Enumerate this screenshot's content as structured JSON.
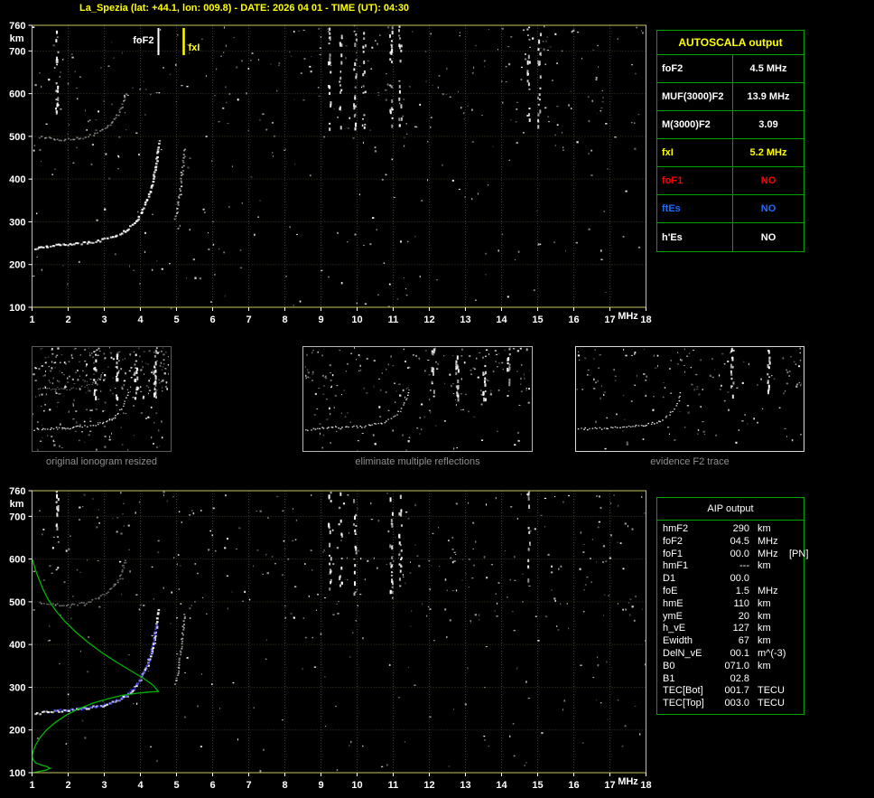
{
  "header": {
    "title": "La_Spezia (lat: +44.1, lon: 009.8) - DATE: 2026 04 01 - TIME (UT): 04:30"
  },
  "colors": {
    "title": "#ffff00",
    "chart_border": "#c6c65e",
    "grid": "#3c3c26",
    "axis_text": "#ffffff",
    "table_border": "#00a400",
    "caption": "#909090",
    "profile_green": "#00b400",
    "trace_blue": "#3b3bff",
    "marker_foF2": "#ffffff",
    "marker_fxI": "#ffff00",
    "status_red": "#ff0000",
    "status_blue": "#1e6bff"
  },
  "autoscala_table": {
    "title": "AUTOSCALA output",
    "rows": [
      {
        "label": "foF2",
        "value": "4.5 MHz",
        "color": "#ffffff"
      },
      {
        "label": "MUF(3000)F2",
        "value": "13.9 MHz",
        "color": "#ffffff"
      },
      {
        "label": "M(3000)F2",
        "value": "3.09",
        "color": "#ffffff"
      },
      {
        "label": "fxI",
        "value": "5.2 MHz",
        "color": "#ffff00"
      },
      {
        "label": "foF1",
        "value": "NO",
        "color": "#ff0000"
      },
      {
        "label": "ftEs",
        "value": "NO",
        "color": "#1e6bff"
      },
      {
        "label": "h'Es",
        "value": "NO",
        "color": "#ffffff"
      }
    ]
  },
  "aip_table": {
    "title": "AIP output",
    "rows": [
      {
        "label": "hmF2",
        "value": "290",
        "unit": "km",
        "note": ""
      },
      {
        "label": "foF2",
        "value": "04.5",
        "unit": "MHz",
        "note": ""
      },
      {
        "label": "foF1",
        "value": "00.0",
        "unit": "MHz",
        "note": "[PN]"
      },
      {
        "label": "hmF1",
        "value": "---",
        "unit": "km",
        "note": ""
      },
      {
        "label": "D1",
        "value": "00.0",
        "unit": "",
        "note": ""
      },
      {
        "label": "foE",
        "value": "1.5",
        "unit": "MHz",
        "note": ""
      },
      {
        "label": "hmE",
        "value": "110",
        "unit": "km",
        "note": ""
      },
      {
        "label": "ymE",
        "value": "20",
        "unit": "km",
        "note": ""
      },
      {
        "label": "h_vE",
        "value": "127",
        "unit": "km",
        "note": ""
      },
      {
        "label": "Ewidth",
        "value": "67",
        "unit": "km",
        "note": ""
      },
      {
        "label": "DelN_vE",
        "value": "00.1",
        "unit": "m^(-3)",
        "note": ""
      },
      {
        "label": "B0",
        "value": "071.0",
        "unit": "km",
        "note": ""
      },
      {
        "label": "B1",
        "value": "02.8",
        "unit": "",
        "note": ""
      },
      {
        "label": "TEC[Bot]",
        "value": "001.7",
        "unit": "TECU",
        "note": ""
      },
      {
        "label": "TEC[Top]",
        "value": "003.0",
        "unit": "TECU",
        "note": ""
      }
    ]
  },
  "thumbnails": [
    {
      "caption": "original ionogram resized",
      "seed": 11,
      "noise": 300,
      "second_hop": true,
      "xlim": [
        1,
        6
      ],
      "interference_MHz": [
        3.3,
        4.1,
        4.8,
        5.5
      ]
    },
    {
      "caption": "eliminate multiple reflections",
      "seed": 23,
      "noise": 210,
      "second_hop": false,
      "xlim": [
        1,
        8.5
      ],
      "interference_MHz": [
        5.3,
        6.1,
        7.0,
        7.8
      ]
    },
    {
      "caption": "evidence F2 trace",
      "seed": 37,
      "noise": 150,
      "second_hop": false,
      "xlim": [
        1,
        8.5
      ],
      "interference_MHz": [
        6.2,
        7.4
      ]
    }
  ],
  "chart_data": [
    {
      "type": "scatter",
      "name": "top ionogram with autoscaled characteristics",
      "xlabel": "MHz",
      "ylabel": "km",
      "xlim": [
        1,
        18
      ],
      "ylim": [
        100,
        760
      ],
      "x_ticks": [
        1,
        2,
        3,
        4,
        5,
        6,
        7,
        8,
        9,
        10,
        11,
        12,
        13,
        14,
        15,
        16,
        17,
        18
      ],
      "y_ticks": [
        760,
        700,
        600,
        500,
        400,
        300,
        200,
        100
      ],
      "markers": {
        "foF2_label": "foF2",
        "foF2_MHz": 4.5,
        "fxI_label": "fxI",
        "fxI_MHz": 5.2
      },
      "noise": {
        "seed": 7,
        "count": 430
      },
      "interference_MHz": [
        1.7,
        9.25,
        9.55,
        9.95,
        10.2,
        10.95,
        11.2,
        14.75,
        15.05
      ],
      "interference_km": [
        520,
        760
      ],
      "series": [
        {
          "name": "F2 trace (O-mode)",
          "style": "dots",
          "color": "#ffffff",
          "size": 2.6,
          "opacity": 1,
          "points": [
            [
              1.05,
              240
            ],
            [
              1.3,
              243
            ],
            [
              1.6,
              246
            ],
            [
              1.9,
              248
            ],
            [
              2.2,
              250
            ],
            [
              2.5,
              253
            ],
            [
              2.8,
              257
            ],
            [
              3.0,
              261
            ],
            [
              3.2,
              266
            ],
            [
              3.4,
              273
            ],
            [
              3.6,
              283
            ],
            [
              3.8,
              297
            ],
            [
              3.95,
              315
            ],
            [
              4.08,
              336
            ],
            [
              4.2,
              360
            ],
            [
              4.3,
              390
            ],
            [
              4.38,
              422
            ],
            [
              4.44,
              455
            ],
            [
              4.48,
              488
            ]
          ]
        },
        {
          "name": "F2 trace second hop",
          "style": "dots",
          "color": "#ffffff",
          "size": 2,
          "opacity": 0.55,
          "points": [
            [
              1.2,
              500
            ],
            [
              1.5,
              496
            ],
            [
              1.8,
              494
            ],
            [
              2.1,
              495
            ],
            [
              2.4,
              498
            ],
            [
              2.6,
              503
            ],
            [
              2.8,
              510
            ],
            [
              3.0,
              519
            ],
            [
              3.15,
              530
            ],
            [
              3.3,
              545
            ],
            [
              3.42,
              562
            ],
            [
              3.52,
              582
            ],
            [
              3.6,
              605
            ]
          ]
        },
        {
          "name": "X-mode segment",
          "style": "dots",
          "color": "#ffffff",
          "size": 2,
          "opacity": 0.7,
          "points": [
            [
              4.95,
              310
            ],
            [
              5.02,
              340
            ],
            [
              5.08,
              372
            ],
            [
              5.13,
              408
            ],
            [
              5.17,
              444
            ],
            [
              5.2,
              478
            ]
          ]
        }
      ]
    },
    {
      "type": "scatter",
      "name": "bottom ionogram with autoscaled trace and electron density profile",
      "xlabel": "MHz",
      "ylabel": "km",
      "xlim": [
        1,
        18
      ],
      "ylim": [
        100,
        760
      ],
      "x_ticks": [
        1,
        2,
        3,
        4,
        5,
        6,
        7,
        8,
        9,
        10,
        11,
        12,
        13,
        14,
        15,
        16,
        17,
        18
      ],
      "y_ticks": [
        760,
        700,
        600,
        500,
        400,
        300,
        200,
        100
      ],
      "noise": {
        "seed": 19,
        "count": 430
      },
      "interference_MHz": [
        1.7,
        9.25,
        9.55,
        9.95,
        10.95,
        11.2,
        14.75
      ],
      "interference_km": [
        520,
        760
      ],
      "series": [
        {
          "name": "F2 trace (O-mode)",
          "style": "dots",
          "color": "#ffffff",
          "size": 2.6,
          "opacity": 1,
          "points": [
            [
              1.05,
              240
            ],
            [
              1.3,
              243
            ],
            [
              1.6,
              246
            ],
            [
              1.9,
              248
            ],
            [
              2.2,
              250
            ],
            [
              2.5,
              253
            ],
            [
              2.8,
              257
            ],
            [
              3.0,
              261
            ],
            [
              3.2,
              266
            ],
            [
              3.4,
              273
            ],
            [
              3.6,
              283
            ],
            [
              3.8,
              297
            ],
            [
              3.95,
              315
            ],
            [
              4.08,
              336
            ],
            [
              4.2,
              360
            ],
            [
              4.3,
              390
            ],
            [
              4.38,
              422
            ],
            [
              4.44,
              455
            ],
            [
              4.48,
              488
            ]
          ]
        },
        {
          "name": "F2 trace second hop",
          "style": "dots",
          "color": "#ffffff",
          "size": 2,
          "opacity": 0.45,
          "points": [
            [
              1.2,
              500
            ],
            [
              1.5,
              496
            ],
            [
              1.8,
              494
            ],
            [
              2.1,
              495
            ],
            [
              2.4,
              498
            ],
            [
              2.6,
              503
            ],
            [
              2.8,
              510
            ],
            [
              3.0,
              519
            ],
            [
              3.15,
              530
            ],
            [
              3.3,
              545
            ],
            [
              3.42,
              562
            ],
            [
              3.52,
              582
            ],
            [
              3.6,
              605
            ]
          ]
        },
        {
          "name": "X-mode segment",
          "style": "dots",
          "color": "#ffffff",
          "size": 2,
          "opacity": 0.7,
          "points": [
            [
              4.95,
              310
            ],
            [
              5.02,
              340
            ],
            [
              5.08,
              372
            ],
            [
              5.13,
              408
            ],
            [
              5.17,
              444
            ],
            [
              5.2,
              478
            ]
          ]
        },
        {
          "name": "autoscaled F2 trace",
          "style": "dots",
          "color": "#3b3bff",
          "size": 2.2,
          "opacity": 0.95,
          "points": [
            [
              1.6,
              246
            ],
            [
              1.9,
              248
            ],
            [
              2.2,
              250
            ],
            [
              2.5,
              253
            ],
            [
              2.8,
              257
            ],
            [
              3.0,
              261
            ],
            [
              3.2,
              266
            ],
            [
              3.4,
              273
            ],
            [
              3.6,
              283
            ],
            [
              3.8,
              297
            ],
            [
              3.95,
              315
            ],
            [
              4.08,
              336
            ],
            [
              4.2,
              360
            ],
            [
              4.3,
              390
            ],
            [
              4.38,
              422
            ],
            [
              4.44,
              455
            ]
          ]
        },
        {
          "name": "electron density profile",
          "style": "line",
          "color": "#00b400",
          "points": [
            [
              1.02,
              100
            ],
            [
              1.2,
              103
            ],
            [
              1.38,
              106
            ],
            [
              1.5,
              110
            ],
            [
              1.42,
              114
            ],
            [
              1.25,
              118
            ],
            [
              1.1,
              123
            ],
            [
              1.03,
              130
            ],
            [
              1.0,
              138
            ],
            [
              1.03,
              150
            ],
            [
              1.1,
              165
            ],
            [
              1.22,
              182
            ],
            [
              1.4,
              200
            ],
            [
              1.65,
              218
            ],
            [
              1.95,
              235
            ],
            [
              2.3,
              250
            ],
            [
              2.7,
              263
            ],
            [
              3.1,
              273
            ],
            [
              3.5,
              281
            ],
            [
              3.9,
              286
            ],
            [
              4.25,
              289
            ],
            [
              4.5,
              290
            ],
            [
              4.35,
              305
            ],
            [
              4.1,
              320
            ],
            [
              3.75,
              338
            ],
            [
              3.35,
              358
            ],
            [
              2.95,
              380
            ],
            [
              2.55,
              405
            ],
            [
              2.2,
              430
            ],
            [
              1.9,
              455
            ],
            [
              1.65,
              480
            ],
            [
              1.45,
              505
            ],
            [
              1.3,
              530
            ],
            [
              1.18,
              555
            ],
            [
              1.08,
              578
            ],
            [
              1.02,
              598
            ]
          ]
        }
      ]
    }
  ]
}
